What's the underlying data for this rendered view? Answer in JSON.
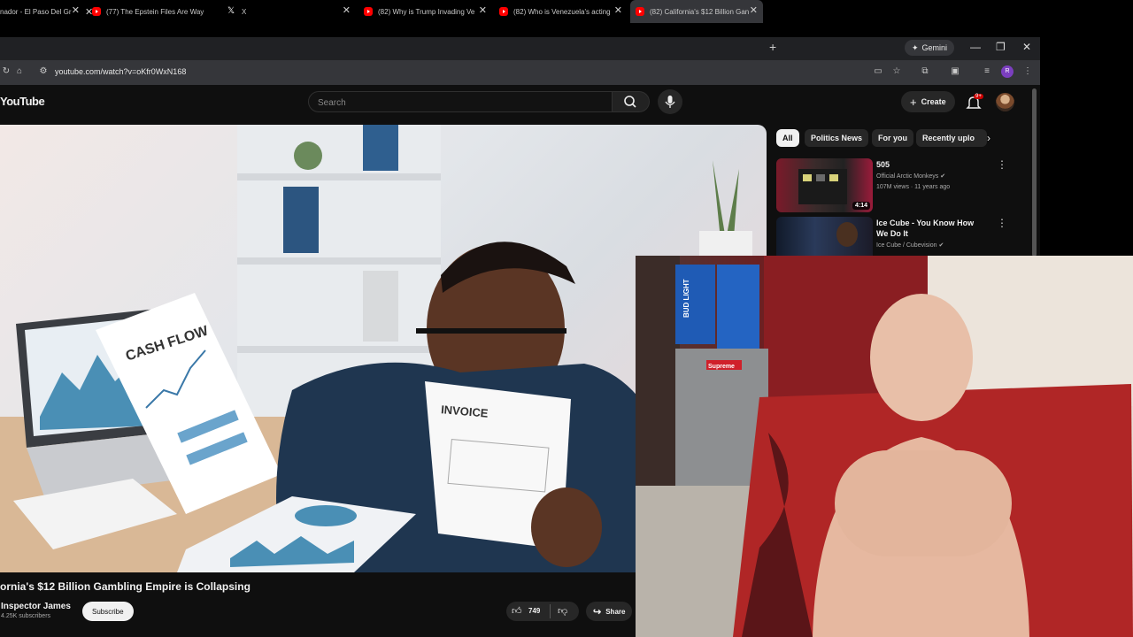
{
  "browser": {
    "tabs": [
      {
        "title": "nador - El Paso Del Gr",
        "favicon": "youtube-icon"
      },
      {
        "title": "(77) The Epstein Files Are Way",
        "favicon": "youtube-icon"
      },
      {
        "title": "X",
        "favicon": "x-icon"
      },
      {
        "title": "(82) Why is Trump Invading Ve",
        "favicon": "youtube-icon"
      },
      {
        "title": "(82) Who is Venezuela's acting",
        "favicon": "youtube-icon"
      },
      {
        "title": "(82) California's $12 Billion Gan",
        "favicon": "youtube-icon",
        "active": true
      }
    ],
    "gemini_label": "Gemini",
    "url": "youtube.com/watch?v=oKfr0WxN168",
    "profile_initial": "R"
  },
  "youtube": {
    "logo_text": "YouTube",
    "search_placeholder": "Search",
    "create_label": "Create",
    "notification_badge": "9+"
  },
  "video": {
    "title": "ornia's $12 Billion Gambling Empire is Collapsing",
    "channel": "Inspector James",
    "subscribers": "4.25K subscribers",
    "subscribe_label": "Subscribe",
    "likes": "749",
    "share_label": "Share",
    "thumbnail_text": {
      "doc1": "CASH FLOW",
      "doc2": "INVOICE"
    }
  },
  "sidebar": {
    "chips": [
      "All",
      "Politics News",
      "For you",
      "Recently uplo"
    ],
    "recommendations": [
      {
        "title": "505",
        "channel": "Official Arctic Monkeys",
        "meta": "107M views · 11 years ago",
        "duration": "4:14"
      },
      {
        "title": "Ice Cube - You Know How We Do It",
        "channel": "Ice Cube / Cubevision",
        "meta": ""
      }
    ]
  },
  "webcam": {
    "props": {
      "box_brand": "BUD LIGHT",
      "sticker": "Supreme"
    }
  }
}
